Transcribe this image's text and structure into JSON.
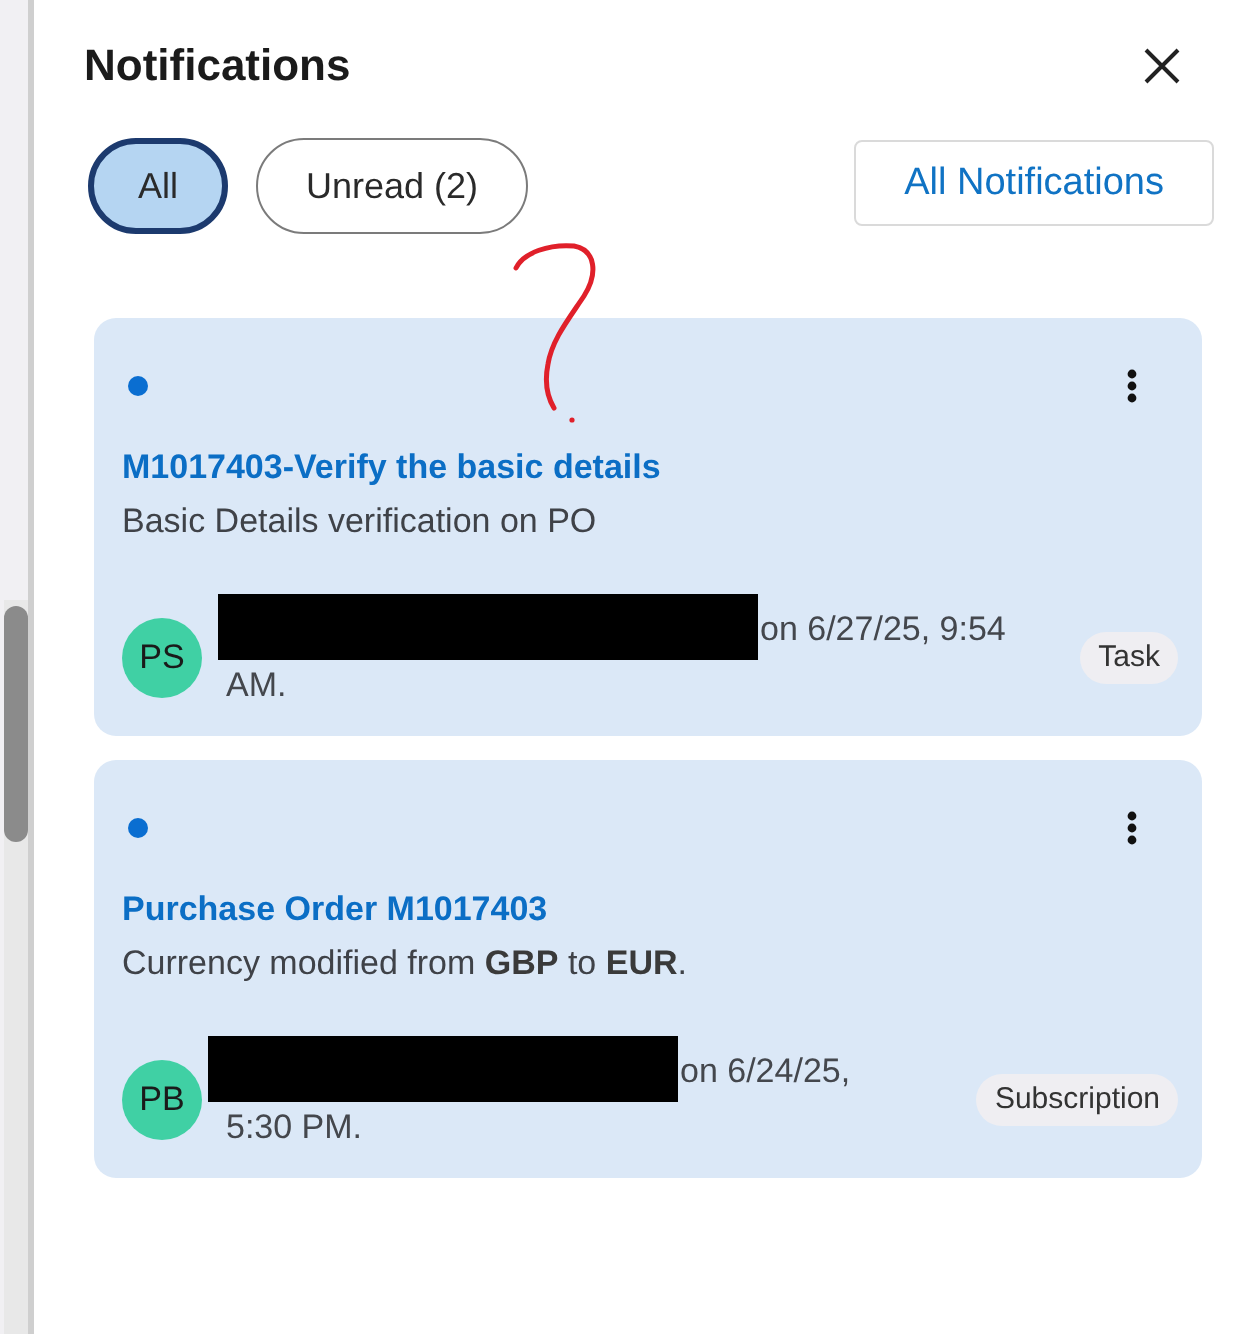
{
  "header": {
    "title": "Notifications"
  },
  "filters": [
    {
      "label": "All",
      "selected": true
    },
    {
      "label": "Unread (2)",
      "selected": false
    }
  ],
  "all_notifications_button": "All Notifications",
  "notifications": [
    {
      "unread": true,
      "title": "M1017403-Verify the basic details",
      "message": "Basic Details verification on PO",
      "avatar_initials": "PS",
      "sender_redacted": true,
      "time_text": "on 6/27/25, 9:54 AM.",
      "tag": "Task"
    },
    {
      "unread": true,
      "title": "Purchase Order M1017403",
      "message": "Currency modified from **GBP** to **EUR**.",
      "avatar_initials": "PB",
      "sender_redacted": true,
      "time_text": "on 6/24/25, 5:30 PM.",
      "tag": "Subscription"
    }
  ]
}
